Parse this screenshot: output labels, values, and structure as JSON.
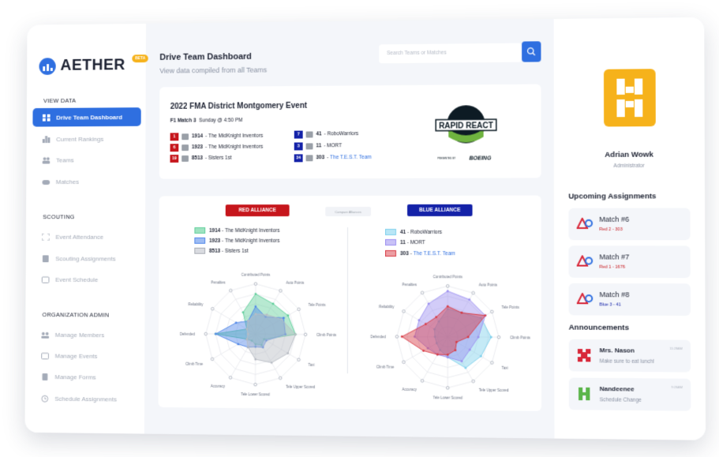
{
  "app": {
    "name": "AETHER",
    "badge": "BETA"
  },
  "sidebar": {
    "sections": [
      {
        "title": "VIEW DATA",
        "items": [
          {
            "label": "Drive Team Dashboard",
            "icon": "grid-icon",
            "active": true
          },
          {
            "label": "Current Rankings",
            "icon": "podium-icon"
          },
          {
            "label": "Teams",
            "icon": "people-icon"
          },
          {
            "label": "Matches",
            "icon": "gamepad-icon"
          }
        ]
      },
      {
        "title": "SCOUTING",
        "items": [
          {
            "label": "Event Attendance",
            "icon": "scan-icon"
          },
          {
            "label": "Scouting Assignments",
            "icon": "clipboard-icon"
          },
          {
            "label": "Event Schedule",
            "icon": "calendar-icon"
          }
        ]
      },
      {
        "title": "ORGANIZATION ADMIN",
        "items": [
          {
            "label": "Manage Members",
            "icon": "members-icon"
          },
          {
            "label": "Manage Events",
            "icon": "calendar-icon"
          },
          {
            "label": "Manage Forms",
            "icon": "form-icon"
          },
          {
            "label": "Schedule Assignments",
            "icon": "clock-icon"
          }
        ]
      }
    ]
  },
  "header": {
    "title": "Drive Team Dashboard",
    "subtitle": "View data compiled from all Teams",
    "search_placeholder": "Search Teams or Matches"
  },
  "event": {
    "title": "2022 FMA District Montgomery Event",
    "match": "F1 Match 3",
    "time": "Sunday @ 4:50 PM",
    "red": [
      {
        "seed": "1",
        "number": "1914",
        "name": "The MidKnight Inventors"
      },
      {
        "seed": "6",
        "number": "1923",
        "name": "The MidKnight Inventors"
      },
      {
        "seed": "19",
        "number": "8513",
        "name": "Sisters 1st"
      }
    ],
    "blue": [
      {
        "seed": "7",
        "number": "41",
        "name": "RoboWarriors"
      },
      {
        "seed": "3",
        "number": "11",
        "name": "MORT"
      },
      {
        "seed": "34",
        "number": "303",
        "name": "The T.E.S.T. Team"
      }
    ],
    "game_logo": {
      "name": "RAPID REACT",
      "presented_by": "PRESENTED BY",
      "sponsor": "BOEING"
    }
  },
  "alliances": {
    "red_label": "RED ALLIANCE",
    "blue_label": "BLUE ALLIANCE",
    "compare_label": "Compare Alliances",
    "colors": {
      "red": "#c6161c",
      "blue": "#1422a8",
      "link": "#2f6fe0"
    }
  },
  "chart_data": [
    {
      "type": "radar",
      "axes": [
        "Contributed Points",
        "Auto Points",
        "Tele Points",
        "Climb Points",
        "Taxi",
        "Tele Upper Scored",
        "Tele Lower Scored",
        "Accuracy",
        "Climb Time",
        "Defended",
        "Reliability",
        "Penalties"
      ],
      "series": [
        {
          "name": "1914 - The MidKnight Inventors",
          "color": "#5fce9a",
          "values": [
            0.8,
            0.7,
            0.75,
            0.8,
            0.2,
            0.25,
            0.2,
            0.15,
            0.2,
            0.8,
            0.2,
            0.5
          ]
        },
        {
          "name": "1923 - The MidKnight Inventors",
          "color": "#4f86e8",
          "values": [
            0.55,
            0.4,
            0.65,
            0.6,
            0.25,
            0.3,
            0.25,
            0.3,
            0.4,
            0.8,
            0.45,
            0.3
          ]
        },
        {
          "name": "8513 - Sisters 1st",
          "color": "#b8bcc4",
          "values": [
            0.4,
            0.45,
            0.6,
            0.8,
            0.75,
            0.65,
            0.5,
            0.3,
            0.2,
            0.15,
            0.2,
            0.3
          ]
        }
      ]
    },
    {
      "type": "radar",
      "axes": [
        "Contributed Points",
        "Auto Points",
        "Tele Points",
        "Climb Points",
        "Taxi",
        "Tele Upper Scored",
        "Tele Lower Scored",
        "Accuracy",
        "Climb Time",
        "Defended",
        "Reliability",
        "Penalties"
      ],
      "series": [
        {
          "name": "41 - RoboWarriors",
          "color": "#7fd0ec",
          "values": [
            0.55,
            0.55,
            0.75,
            0.85,
            0.75,
            0.7,
            0.4,
            0.3,
            0.25,
            0.25,
            0.3,
            0.35
          ]
        },
        {
          "name": "11 - MORT",
          "color": "#9b8ff0",
          "values": [
            0.9,
            0.85,
            0.85,
            0.6,
            0.5,
            0.55,
            0.4,
            0.4,
            0.45,
            0.65,
            0.65,
            0.75
          ]
        },
        {
          "name": "303 - The T.E.S.T. Team",
          "color": "#d83a44",
          "values": [
            0.6,
            0.55,
            0.85,
            0.4,
            0.2,
            0.3,
            0.35,
            0.4,
            0.55,
            0.9,
            0.5,
            0.45
          ]
        }
      ]
    }
  ],
  "user": {
    "name": "Adrian Wowk",
    "role": "Administrator"
  },
  "assignments": {
    "title": "Upcoming Assignments",
    "items": [
      {
        "title": "Match #6",
        "sub": "Red 2 - 303",
        "color": "#c6161c"
      },
      {
        "title": "Match #7",
        "sub": "Red 1 - 1676",
        "color": "#c6161c"
      },
      {
        "title": "Match #8",
        "sub": "Blue 3 - 41",
        "color": "#1422a8"
      }
    ]
  },
  "announcements": {
    "title": "Announcements",
    "items": [
      {
        "name": "Mrs. Nason",
        "message": "Make sure to eat lunch!",
        "time": "11:28AM",
        "color": "#d8283a"
      },
      {
        "name": "Nandeenee",
        "message": "Schedule Change",
        "time": "9:26AM",
        "color": "#5bb54a"
      }
    ]
  }
}
